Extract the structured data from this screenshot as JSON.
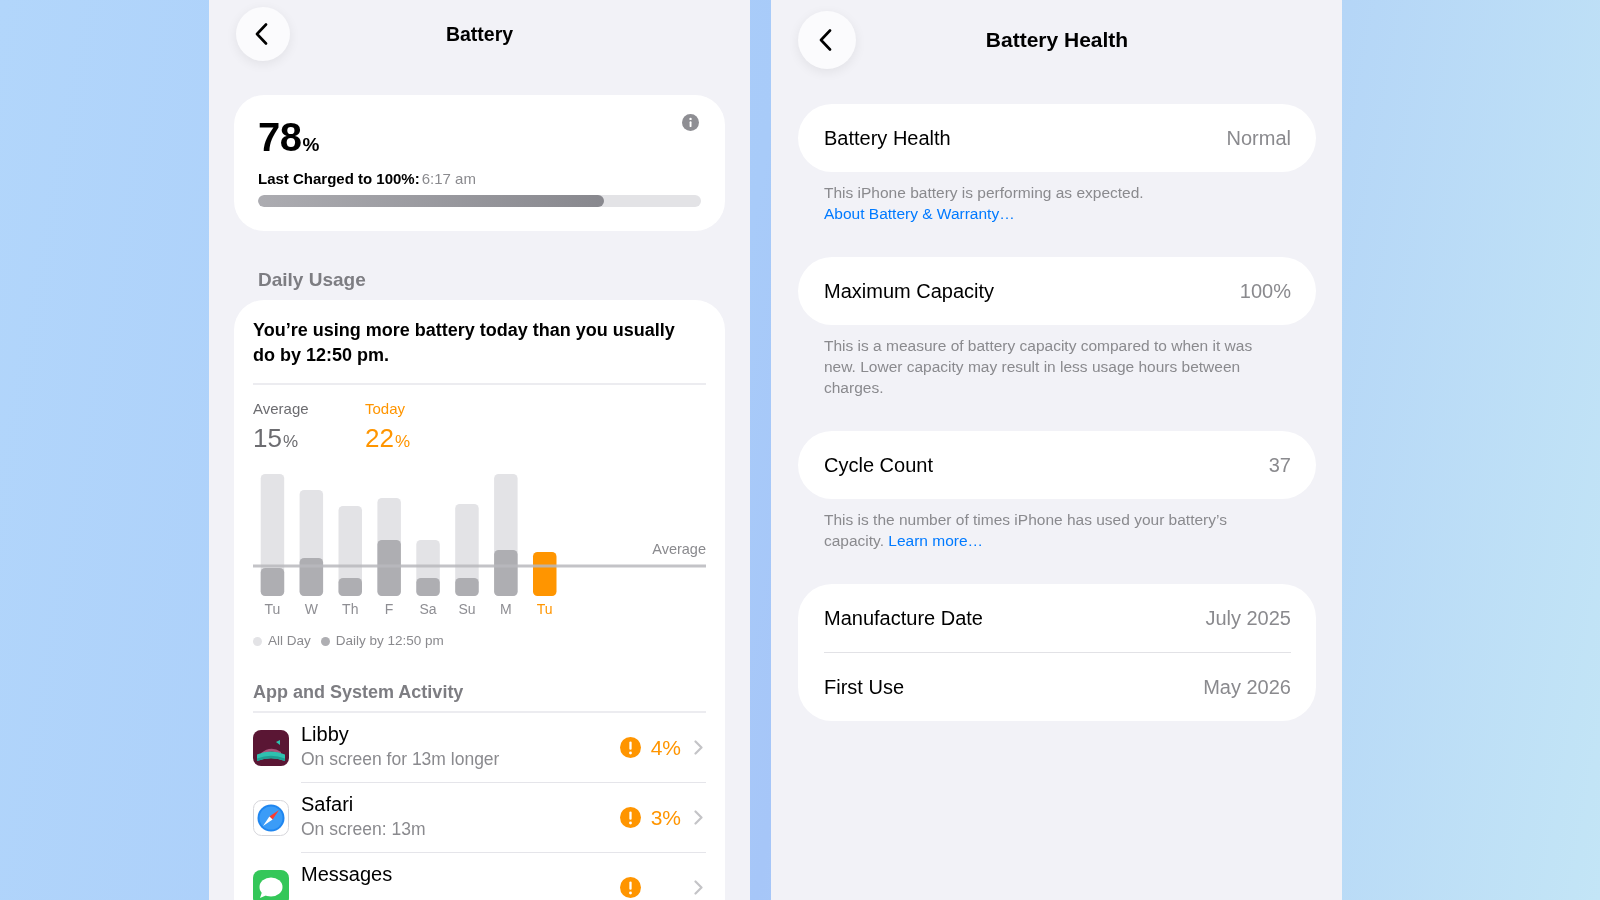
{
  "battery_screen": {
    "title": "Battery",
    "charge_card": {
      "percent": "78",
      "unit": "%",
      "last_charged_label": "Last Charged to 100%:",
      "last_charged_time": "6:17 am",
      "level": 0.78
    },
    "daily_usage": {
      "heading": "Daily Usage",
      "message": "You’re using more battery today than you usually do by 12:50 pm.",
      "stats": [
        {
          "label": "Average",
          "value": "15",
          "unit": "%",
          "color": "#6c6c70"
        },
        {
          "label": "Today",
          "value": "22",
          "unit": "%",
          "color": "#ff9500"
        }
      ],
      "usage_chart": {
        "days": [
          {
            "label": "Tu",
            "selected": false
          },
          {
            "label": "W",
            "selected": false
          },
          {
            "label": "Th",
            "selected": false
          },
          {
            "label": "F",
            "selected": false
          },
          {
            "label": "Sa",
            "selected": false
          },
          {
            "label": "Su",
            "selected": false
          },
          {
            "label": "M",
            "selected": false
          },
          {
            "label": "Tu",
            "selected": true
          }
        ],
        "average_label": "Average",
        "legend": [
          {
            "label": "All Day",
            "color": "#e3e3e6"
          },
          {
            "label": "Daily by 12:50 pm",
            "color": "#aeaeb2"
          }
        ]
      },
      "activity_heading": "App and System Activity",
      "apps": [
        {
          "name": "Libby",
          "detail": "On screen for 13m longer",
          "percent": "4%",
          "warning": true
        },
        {
          "name": "Safari",
          "detail": "On screen: 13m",
          "percent": "3%",
          "warning": true
        },
        {
          "name": "Messages",
          "warning": true
        }
      ]
    }
  },
  "battery_health_screen": {
    "title": "Battery Health",
    "groups": [
      {
        "rows": [
          {
            "label": "Battery Health",
            "value": "Normal"
          }
        ],
        "footnote": {
          "text": "This iPhone battery is performing as expected.",
          "link": "About Battery & Warranty…"
        }
      },
      {
        "rows": [
          {
            "label": "Maximum Capacity",
            "value": "100%"
          }
        ],
        "footnote": {
          "text": "This is a measure of battery capacity compared to when it was new. Lower capacity may result in less usage hours between charges."
        }
      },
      {
        "rows": [
          {
            "label": "Cycle Count",
            "value": "37"
          }
        ],
        "footnote": {
          "text": "This is the number of times iPhone has used your battery’s capacity.",
          "link": "Learn more…"
        }
      },
      {
        "rows": [
          {
            "label": "Manufacture Date",
            "value": "July 2025"
          },
          {
            "label": "First Use",
            "value": "May 2026"
          }
        ]
      }
    ]
  }
}
